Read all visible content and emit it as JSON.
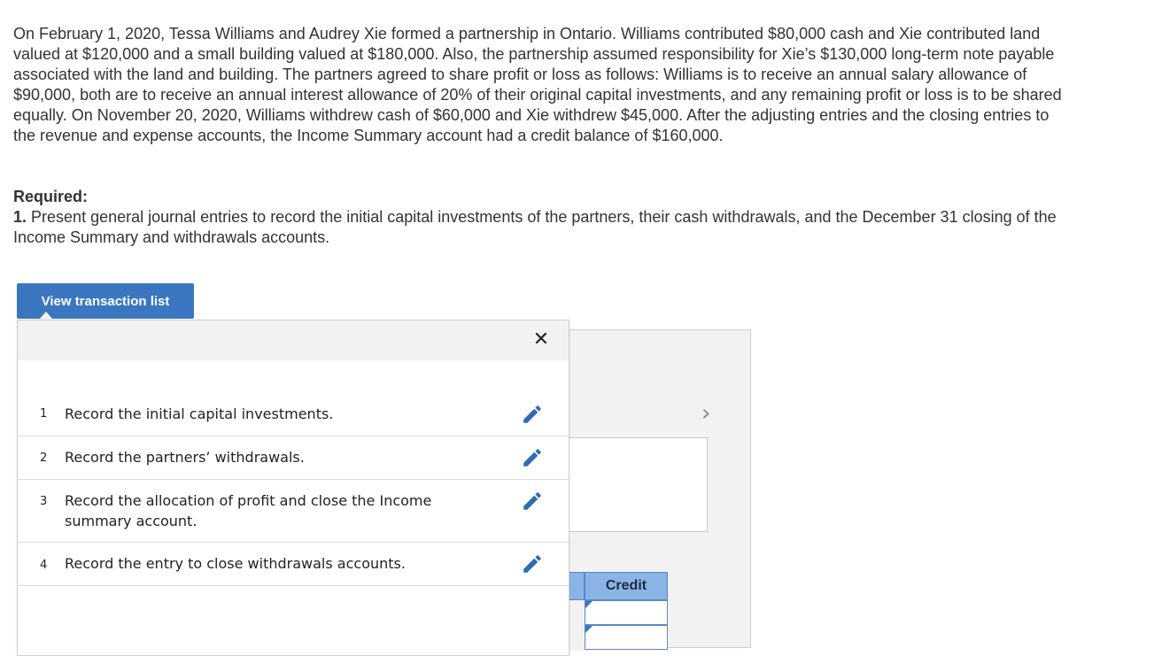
{
  "problem": {
    "paragraph": "On February 1, 2020, Tessa Williams and Audrey Xie formed a partnership in Ontario. Williams contributed $80,000 cash and Xie contributed land valued at $120,000 and a small building valued at $180,000. Also, the partnership assumed responsibility for Xie’s $130,000 long-term note payable associated with the land and building. The partners agreed to share profit or loss as follows: Williams is to receive an annual salary allowance of $90,000, both are to receive an annual interest allowance of 20% of their original capital investments, and any remaining profit or loss is to be shared equally. On November 20, 2020, Williams withdrew cash of $60,000 and Xie withdrew $45,000. After the adjusting entries and the closing entries to the revenue and expense accounts, the Income Summary account had a credit balance of $160,000.",
    "required_label": "Required:",
    "req1_num": "1.",
    "req1_text": "Present general journal entries to record the initial capital investments of the partners, their cash withdrawals, and the December 31 closing of the Income Summary and withdrawals accounts."
  },
  "view_button": {
    "label": "View transaction list"
  },
  "popup": {
    "close_glyph": "✕",
    "transactions": [
      {
        "num": "1",
        "text": "Record the initial capital investments."
      },
      {
        "num": "2",
        "text": "Record the partners’ withdrawals."
      },
      {
        "num": "3",
        "text": "Record the allocation of profit and close the Income summary account."
      },
      {
        "num": "4",
        "text": "Record the entry to close withdrawals accounts."
      }
    ],
    "edit_icon": "pencil-icon"
  },
  "worksheet": {
    "next_glyph": "›",
    "credit_header": "Credit"
  },
  "colors": {
    "accent": "#3a77c0",
    "header_blue": "#8ab4e6",
    "panel_gray": "#f2f2f2"
  }
}
